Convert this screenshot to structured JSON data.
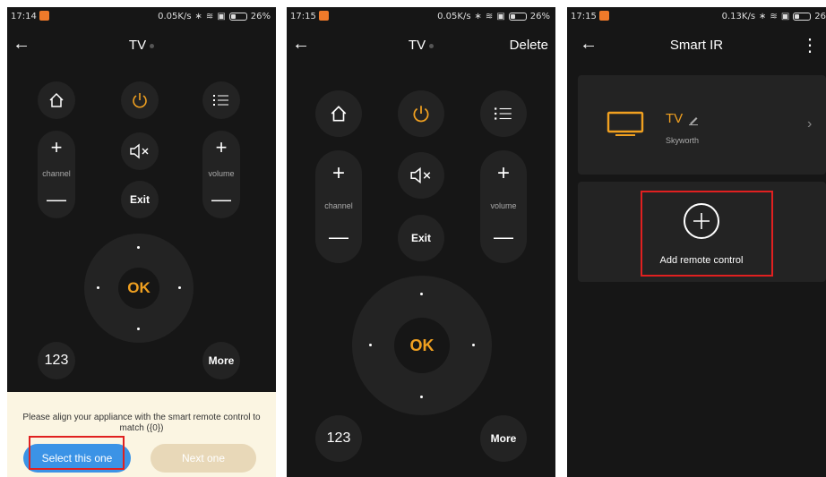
{
  "panel1": {
    "status": {
      "time": "17:14",
      "net": "0.05K/s",
      "battery": "26%"
    },
    "header": {
      "title": "TV"
    },
    "remote": {
      "channel_label": "channel",
      "volume_label": "volume",
      "exit_label": "Exit",
      "ok_label": "OK",
      "numpad_label": "123",
      "more_label": "More"
    },
    "prompt": {
      "message": "Please align your appliance with the smart remote control to match ({0})",
      "select_label": "Select this one",
      "next_label": "Next one"
    }
  },
  "panel2": {
    "status": {
      "time": "17:15",
      "net": "0.05K/s",
      "battery": "26%"
    },
    "header": {
      "title": "TV",
      "delete_label": "Delete"
    },
    "remote": {
      "channel_label": "channel",
      "volume_label": "volume",
      "exit_label": "Exit",
      "ok_label": "OK",
      "numpad_label": "123",
      "more_label": "More"
    }
  },
  "panel3": {
    "status": {
      "time": "17:15",
      "net": "0.13K/s",
      "battery": "26"
    },
    "header": {
      "title": "Smart IR"
    },
    "device": {
      "name": "TV",
      "brand": "Skyworth"
    },
    "add": {
      "label": "Add remote control"
    }
  },
  "colors": {
    "background": "#161616",
    "button": "#232323",
    "accent": "#f0a020",
    "highlight": "#e02020",
    "primary_button": "#3b93e6"
  },
  "icons": [
    "back-arrow-icon",
    "home-icon",
    "power-icon",
    "menu-list-icon",
    "mute-icon",
    "plus-icon",
    "minus-icon",
    "edit-pencil-icon",
    "tv-icon",
    "chevron-right-icon",
    "more-vertical-icon",
    "add-circle-icon"
  ]
}
